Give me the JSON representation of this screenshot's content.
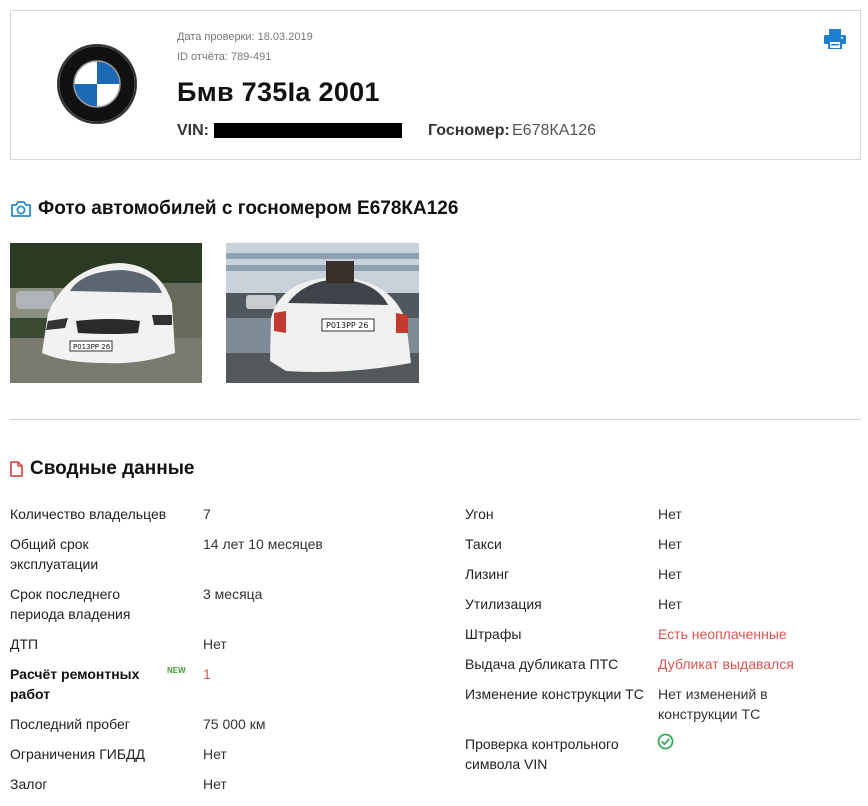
{
  "header": {
    "check_date": "Дата проверки: 18.03.2019",
    "report_id": "ID отчёта: 789-491",
    "car_title": "Бмв 735Ia 2001",
    "vin_label": "VIN:",
    "plate_label": "Госномер:",
    "plate_value": "Е678КА126",
    "logo_icon": "bmw-logo",
    "print_icon": "printer-icon"
  },
  "photos": {
    "title": "Фото автомобилей с госномером Е678КА126",
    "icon": "camera-icon",
    "items": [
      {
        "plate": "Р013РР 26"
      },
      {
        "plate": "Р013РР 26"
      }
    ]
  },
  "summary": {
    "title": "Сводные данные",
    "icon": "document-icon",
    "left": [
      {
        "label": "Количество владельцев",
        "value": "7"
      },
      {
        "label": "Общий срок эксплуатации",
        "value": "14 лет 10 месяцев"
      },
      {
        "label": "Срок последнего периода владения",
        "value": "3 месяца"
      },
      {
        "label": "ДТП",
        "value": "Нет"
      },
      {
        "label": "Расчёт ремонтных работ",
        "value": "1",
        "badge": "NEW"
      },
      {
        "label": "Последний пробег",
        "value": "75 000 км"
      },
      {
        "label": "Ограничения ГИБДД",
        "value": "Нет"
      },
      {
        "label": "Залог",
        "value": "Нет"
      }
    ],
    "right": [
      {
        "label": "Угон",
        "value": "Нет"
      },
      {
        "label": "Такси",
        "value": "Нет"
      },
      {
        "label": "Лизинг",
        "value": "Нет"
      },
      {
        "label": "Утилизация",
        "value": "Нет"
      },
      {
        "label": "Штрафы",
        "value": "Есть неоплаченные"
      },
      {
        "label": "Выдача дубликата ПТС",
        "value": "Дубликат выдавался"
      },
      {
        "label": "Изменение конструкции ТС",
        "value": "Нет изменений в конструкции ТС"
      },
      {
        "label": "Проверка контрольного символа VIN",
        "value_icon": "check-circle-icon"
      }
    ]
  },
  "colors": {
    "accent_blue": "#1e7fd0",
    "warning_red": "#d9534f",
    "success_green": "#4a9a3a"
  }
}
